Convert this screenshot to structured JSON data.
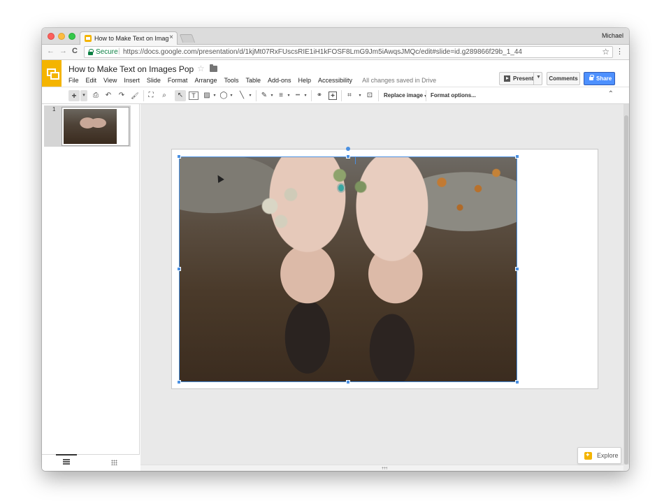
{
  "browser": {
    "tab_title": "How to Make Text on Images P",
    "tab_close": "×",
    "profile_name": "Michael",
    "secure_label": "Secure",
    "url": "https://docs.google.com/presentation/d/1kjMt07RxFUscsRIE1iH1kFOSF8LmG9Jm5iAwqsJMQc/edit#slide=id.g289866f29b_1_44",
    "icons": {
      "back": "←",
      "forward": "→",
      "reload": "C",
      "bookmark_star": "☆",
      "menu": "⋮"
    }
  },
  "doc": {
    "title": "How to Make Text on Images Pop",
    "star": "☆",
    "menus": [
      "File",
      "Edit",
      "View",
      "Insert",
      "Slide",
      "Format",
      "Arrange",
      "Tools",
      "Table",
      "Add-ons",
      "Help",
      "Accessibility"
    ],
    "save_status": "All changes saved in Drive",
    "present_label": "Present",
    "comments_label": "Comments",
    "share_label": "Share"
  },
  "toolbar": {
    "icons": {
      "new_slide": "+",
      "new_slide_caret": "▾",
      "print": "⎙",
      "undo": "↶",
      "redo": "↷",
      "paint_format": "🖌",
      "zoom_fit": "⛶",
      "zoom": "⌕",
      "select": "↖",
      "text_box": "T",
      "image": "▨",
      "shape": "◯",
      "line": "╲",
      "border_color": "✎",
      "border_weight": "≡",
      "border_dash": "┅",
      "link": "⚭",
      "comment": "+",
      "crop": "⌗",
      "mask": "⊡",
      "collapse": "⌃"
    },
    "replace_image_label": "Replace image",
    "replace_image_caret": "▾",
    "format_options_label": "Format options..."
  },
  "filmstrip": {
    "slides": [
      {
        "number": "1"
      }
    ]
  },
  "explore": {
    "label": "Explore"
  },
  "colors": {
    "accent": "#4a90e2",
    "slides_yellow": "#f4b400",
    "share_blue": "#4d90fe",
    "secure_green": "#0b8043"
  }
}
